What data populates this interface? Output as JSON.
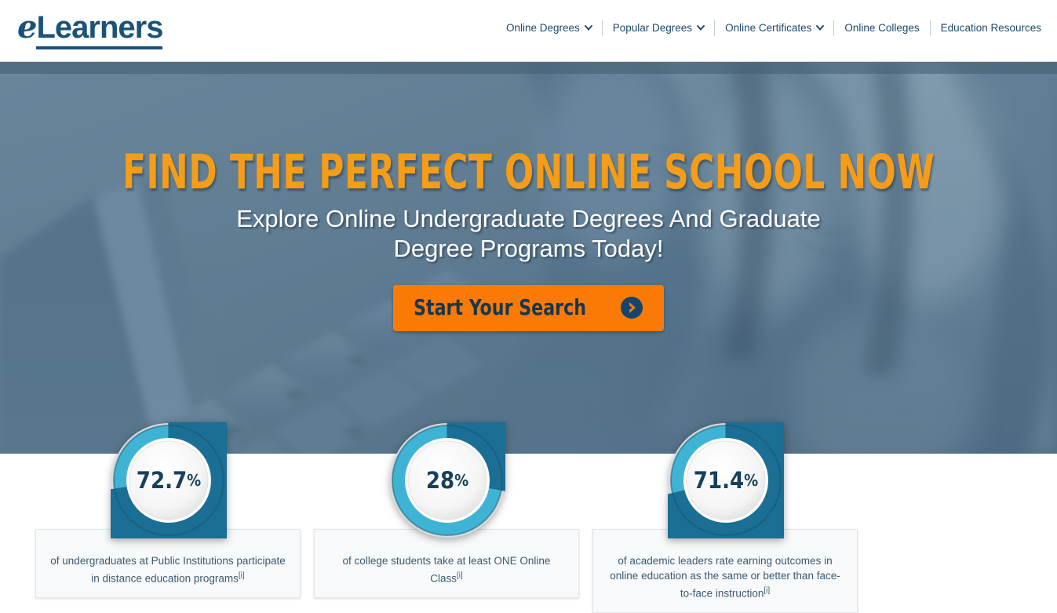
{
  "header": {
    "logo": {
      "prefix": "e",
      "rest": "Learners"
    },
    "nav": [
      {
        "label": "Online Degrees",
        "icon": "chevron-down-icon",
        "has_caret": true,
        "name": "nav-online-degrees"
      },
      {
        "label": "Popular Degrees",
        "icon": "chevron-down-icon",
        "has_caret": true,
        "name": "nav-popular-degrees"
      },
      {
        "label": "Online Certificates",
        "icon": "chevron-down-icon",
        "has_caret": true,
        "name": "nav-online-certificates"
      },
      {
        "label": "Online Colleges",
        "icon": "",
        "has_caret": false,
        "name": "nav-online-colleges"
      },
      {
        "label": "Education Resources",
        "icon": "",
        "has_caret": false,
        "name": "nav-education-resources"
      }
    ]
  },
  "hero": {
    "headline": "FIND THE PERFECT ONLINE SCHOOL NOW",
    "subheadline_line1": "Explore Online Undergraduate Degrees And Graduate",
    "subheadline_line2": "Degree Programs Today!",
    "cta_label": "Start Your Search",
    "cta_icon": "arrow-right-circle-icon",
    "background_image": "hands-typing-on-laptop-keyboard"
  },
  "stats": [
    {
      "value": "72.7",
      "percent_symbol": "%",
      "fill_pct": 72.7,
      "caption": "of undergraduates at Public Institutions participate in distance education programs",
      "footnote": "[i]",
      "name": "stat-undergraduates-distance-education"
    },
    {
      "value": "28",
      "percent_symbol": "%",
      "fill_pct": 28,
      "caption": "of college students take at least ONE Online Class",
      "footnote": "[i]",
      "name": "stat-students-one-online-class"
    },
    {
      "value": "71.4",
      "percent_symbol": "%",
      "fill_pct": 71.4,
      "caption": "of academic leaders rate earning outcomes in online education as the same or better than face-to-face instruction",
      "footnote": "[i]",
      "name": "stat-academic-leaders-outcomes"
    }
  ],
  "colors": {
    "brand_navy": "#1b5278",
    "accent_orange": "#fb7a06",
    "headline_orange": "#f59c19",
    "dial_fill": "#1b6e94",
    "dial_track": "#3fb3d4",
    "caption_text": "#3c5a72",
    "caption_bg": "#f7f9fa"
  }
}
